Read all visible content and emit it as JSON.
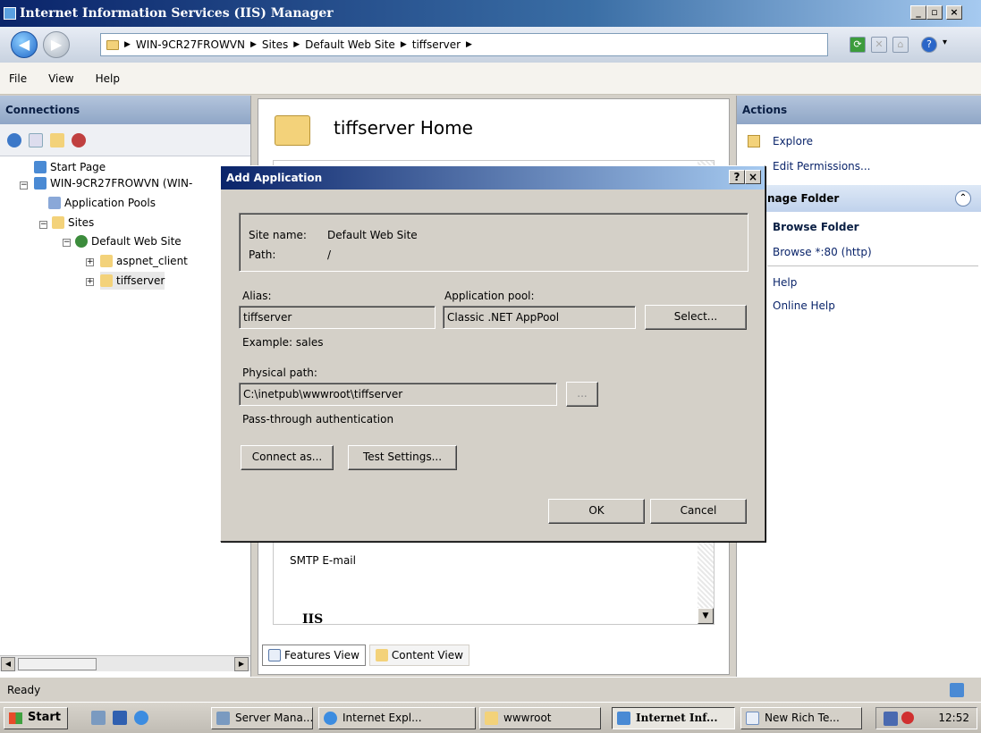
{
  "window": {
    "title": "Internet Information Services (IIS) Manager",
    "min": "_",
    "max": "▫",
    "close": "×"
  },
  "address": {
    "crumbs": [
      "WIN-9CR27FROWVN",
      "Sites",
      "Default Web Site",
      "tiffserver"
    ]
  },
  "menu": [
    "File",
    "View",
    "Help"
  ],
  "connections": {
    "header": "Connections",
    "tree": {
      "start_page": "Start Page",
      "server": "WIN-9CR27FROWVN (WIN-",
      "app_pools": "Application Pools",
      "sites": "Sites",
      "default_site": "Default Web Site",
      "aspnet_client": "aspnet_client",
      "tiffserver": "tiffserver"
    }
  },
  "center": {
    "title": "tiffserver Home",
    "smtp": "SMTP E-mail",
    "iis_group": "IIS",
    "features_view": "Features View",
    "content_view": "Content View"
  },
  "actions": {
    "header": "Actions",
    "explore": "Explore",
    "edit_permissions": "Edit Permissions...",
    "manage_folder": "nage Folder",
    "browse_folder": "Browse Folder",
    "browse_80": "Browse *:80 (http)",
    "help": "Help",
    "online_help": "Online Help"
  },
  "status": "Ready",
  "dialog": {
    "title": "Add Application",
    "help_btn": "?",
    "close_btn": "×",
    "site_name_label": "Site name:",
    "site_name_value": "Default Web Site",
    "path_label": "Path:",
    "path_value": "/",
    "alias_label": "Alias:",
    "alias_value": "tiffserver",
    "pool_label": "Application pool:",
    "pool_value": "Classic .NET AppPool",
    "select_btn": "Select...",
    "example": "Example: sales",
    "physical_label": "Physical path:",
    "physical_value": "C:\\inetpub\\wwwroot\\tiffserver",
    "browse_btn": "...",
    "pass_through": "Pass-through authentication",
    "connect_btn": "Connect as...",
    "test_btn": "Test Settings...",
    "ok_btn": "OK",
    "cancel_btn": "Cancel"
  },
  "taskbar": {
    "start": "Start",
    "tasks": [
      "Server Mana...",
      "Internet Expl...",
      "wwwroot",
      "Internet Inf...",
      "New Rich Te..."
    ],
    "clock": "12:52"
  },
  "colors": {
    "titlebar": "#0a246a",
    "accent": "#3a6ea5",
    "link": "#0a246a"
  }
}
